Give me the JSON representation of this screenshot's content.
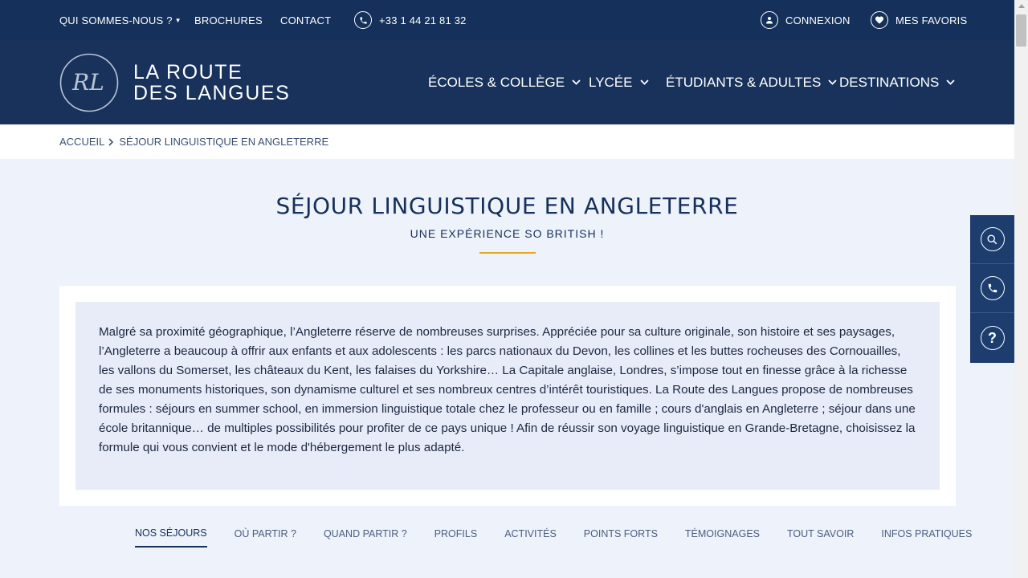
{
  "topbar": {
    "about": "QUI SOMMES-NOUS ?",
    "brochures": "BROCHURES",
    "contact": "CONTACT",
    "phone": "+33 1 44 21 81 32",
    "login": "CONNEXION",
    "favorites": "MES FAVORIS"
  },
  "brand": {
    "line1": "LA ROUTE",
    "line2": "DES LANGUES",
    "monogram": "RL"
  },
  "menu": [
    {
      "label": "ÉCOLES & COLLÈGE"
    },
    {
      "label": "LYCÉE"
    },
    {
      "label": "ÉTUDIANTS & ADULTES"
    },
    {
      "label": "DESTINATIONS"
    }
  ],
  "breadcrumb": {
    "home": "ACCUEIL",
    "current": "SÉJOUR LINGUISTIQUE EN ANGLETERRE"
  },
  "page": {
    "title": "SÉJOUR LINGUISTIQUE EN ANGLETERRE",
    "subtitle": "UNE EXPÉRIENCE SO BRITISH !",
    "intro": "Malgré sa proximité géographique, l’Angleterre réserve de nombreuses surprises. Appréciée pour sa culture originale, son histoire et ses paysages, l’Angleterre a beaucoup à offrir aux enfants et aux adolescents : les parcs nationaux du Devon, les collines et les buttes rocheuses des Cornouailles, les vallons du Somerset, les châteaux du Kent, les falaises du Yorkshire… La Capitale anglaise, Londres, s’impose tout en finesse grâce à la richesse de ses monuments historiques, son dynamisme culturel et ses nombreux centres d’intérêt touristiques. La Route des Langues propose de nombreuses formules : séjours en summer school, en immersion linguistique totale chez le professeur ou en famille ; cours d'anglais en Angleterre ; séjour dans une école britannique… de multiples possibilités pour profiter de ce pays unique ! Afin de réussir son voyage linguistique en Grande-Bretagne, choisissez la formule qui vous convient et le mode d'hébergement le plus adapté."
  },
  "tabs": [
    {
      "label": "NOS SÉJOURS"
    },
    {
      "label": "OÙ PARTIR ?"
    },
    {
      "label": "QUAND PARTIR ?"
    },
    {
      "label": "PROFILS"
    },
    {
      "label": "ACTIVITÉS"
    },
    {
      "label": "POINTS FORTS"
    },
    {
      "label": "TÉMOIGNAGES"
    },
    {
      "label": "TOUT SAVOIR"
    },
    {
      "label": "INFOS PRATIQUES"
    }
  ],
  "sidebar": {
    "help_glyph": "?"
  },
  "colors": {
    "navy": "#15305a",
    "accent": "#e5a823",
    "background": "#eef2fb"
  }
}
